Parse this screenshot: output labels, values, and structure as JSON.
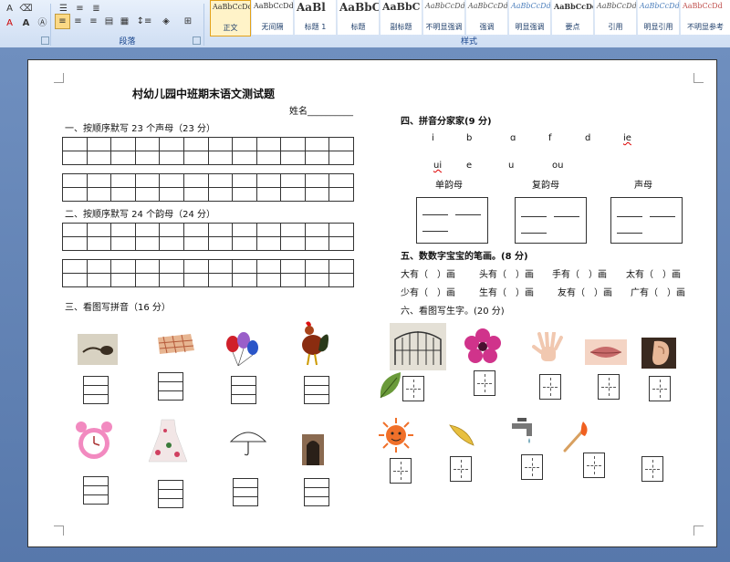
{
  "ribbon": {
    "paragraph_label": "段落",
    "styles_label": "样式",
    "styles": [
      {
        "preview": "AaBbCcDd",
        "name": "正文"
      },
      {
        "preview": "AaBbCcDd",
        "name": "无间隔"
      },
      {
        "preview": "AaBl",
        "name": "标题 1"
      },
      {
        "preview": "AaBbC",
        "name": "标题"
      },
      {
        "preview": "AaBbC",
        "name": "副标题"
      },
      {
        "preview": "AaBbCcDd",
        "name": "不明显强调"
      },
      {
        "preview": "AaBbCcDd",
        "name": "强调"
      },
      {
        "preview": "AaBbCcDd",
        "name": "明显强调"
      },
      {
        "preview": "AaBbCcDd",
        "name": "要点"
      },
      {
        "preview": "AaBbCcDd",
        "name": "引用"
      },
      {
        "preview": "AaBbCcDd",
        "name": "明显引用"
      },
      {
        "preview": "AaBbCcDd",
        "name": "不明显参考"
      }
    ]
  },
  "doc": {
    "title": "村幼儿园中班期末语文测试题",
    "name_label": "姓名__________",
    "q1": "一、按顺序默写 23 个声母（23 分）",
    "q2": "二、按顺序默写 24 个韵母（24 分）",
    "q3": "三、看图写拼音（16 分）",
    "q4": "四、拼音分家家(9 分)",
    "q4_letters_row1": [
      "i",
      "b",
      "ɑ",
      "f",
      "d",
      "ie"
    ],
    "q4_letters_row2": [
      "ui",
      "e",
      "u",
      "ou"
    ],
    "q4_categories": [
      "单韵母",
      "复韵母",
      "声母"
    ],
    "q5": "五、数数字宝宝的笔画。(8 分)",
    "q5_row1": [
      "大有（　）画",
      "头有（　）画",
      "手有（　）画",
      "太有（　）画"
    ],
    "q5_row2": [
      "少有（　）画",
      "生有（　）画",
      "友有（　）画",
      "广有（　）画"
    ],
    "q6": "六、看图写生字。(20 分)"
  }
}
